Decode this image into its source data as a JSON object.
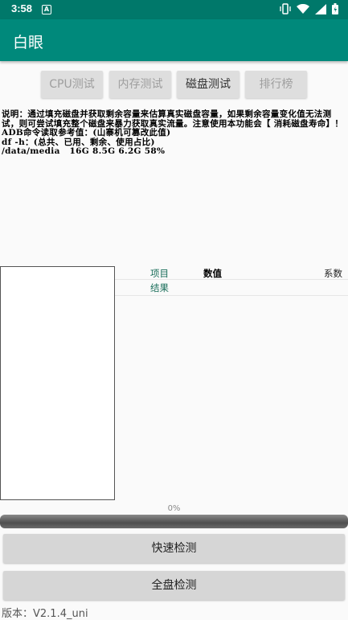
{
  "status": {
    "time": "3:58",
    "notif": "A"
  },
  "app": {
    "title": "白眼"
  },
  "tabs": [
    {
      "label": "CPU测试"
    },
    {
      "label": "内存测试"
    },
    {
      "label": "磁盘测试"
    },
    {
      "label": "排行榜"
    }
  ],
  "description": "说明：通过填充磁盘并获取剩余容量来估算真实磁盘容量，如果剩余容量变化值无法测试，则可尝试填充整个磁盘来暴力获取真实流量。注意使用本功能会【 消耗磁盘寿命】！\nADB命令读取参考值：(山寨机可篡改此值)\ndf -h：(总共、已用、剩余、使用占比)\n/data/media   16G 8.5G 6.2G 58%",
  "table": {
    "headers": [
      "项目",
      "数值",
      "系数"
    ],
    "rows": [
      {
        "label": "结果"
      }
    ]
  },
  "progress": {
    "label": "0%",
    "value": 0
  },
  "buttons": {
    "quick": "快速检测",
    "full": "全盘检测"
  },
  "version": "版本：V2.1.4_uni",
  "colors": {
    "status": "#00786a",
    "primary": "#00897b",
    "header_green": "#1a6e5a"
  }
}
